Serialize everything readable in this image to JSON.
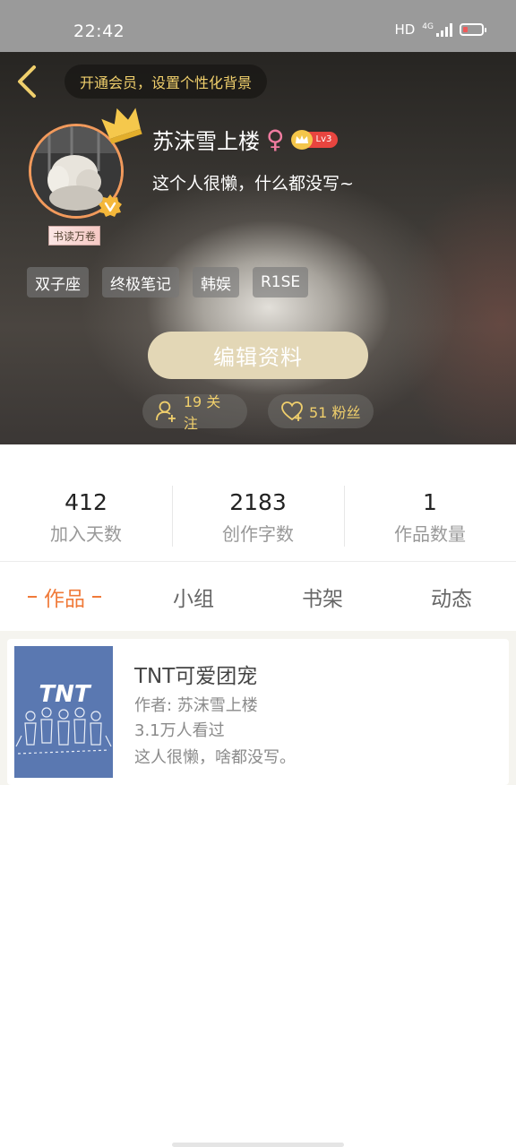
{
  "status_bar": {
    "time": "22:42",
    "network": "HD",
    "signal_type": "4G",
    "icons": [
      "signal-icon",
      "battery-icon"
    ]
  },
  "header": {
    "back_icon": "chevron-left-icon",
    "vip_banner": "开通会员，设置个性化背景",
    "username": "苏沫雪上楼",
    "gender_symbol": "♀",
    "level": "Lv3",
    "bio": "这个人很懒，什么都没写~",
    "reading_badge": "书读万卷",
    "tags": [
      "双子座",
      "终极笔记",
      "韩娱",
      "R1SE"
    ],
    "edit_button": "编辑资料",
    "following_label": "19 关注",
    "fans_label": "51 粉丝",
    "colors": {
      "accent_gold": "#f0cf6c",
      "avatar_ring": "#f29a5c",
      "level_red": "#e8453f"
    }
  },
  "stats": [
    {
      "value": "412",
      "label": "加入天数"
    },
    {
      "value": "2183",
      "label": "创作字数"
    },
    {
      "value": "1",
      "label": "作品数量"
    }
  ],
  "tabs": [
    {
      "label": "作品",
      "active": true
    },
    {
      "label": "小组",
      "active": false
    },
    {
      "label": "书架",
      "active": false
    },
    {
      "label": "动态",
      "active": false
    }
  ],
  "works": [
    {
      "title": "TNT可爱团宠",
      "author": "作者: 苏沫雪上楼",
      "views": "3.1万人看过",
      "description": "这人很懒，啥都没写。",
      "cover_text": "TNT"
    }
  ],
  "accent_color": "#f07a39"
}
